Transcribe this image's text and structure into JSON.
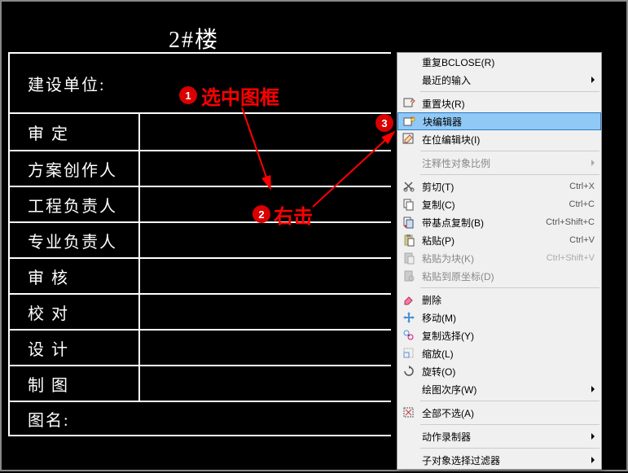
{
  "cad": {
    "title": "2#楼",
    "builder_label": "建设单位:",
    "rows": [
      {
        "label": "审    定"
      },
      {
        "label": "方案创作人"
      },
      {
        "label": "工程负责人"
      },
      {
        "label": "专业负责人"
      },
      {
        "label": "审    核"
      },
      {
        "label": "校    对"
      },
      {
        "label": "设    计"
      },
      {
        "label": "制    图"
      },
      {
        "label": "图名:"
      }
    ]
  },
  "annotations": {
    "badge1": "1",
    "text1": "选中图框",
    "badge2": "2",
    "text2": "右击",
    "badge3": "3"
  },
  "menu": {
    "items": [
      {
        "label": "重复BCLOSE(R)"
      },
      {
        "label": "最近的输入",
        "submenu": true
      },
      {
        "sep": true
      },
      {
        "icon": "reset-block-icon",
        "label": "重置块(R)"
      },
      {
        "icon": "block-editor-icon",
        "label": "块编辑器",
        "highlighted": true
      },
      {
        "icon": "edit-inplace-icon",
        "label": "在位编辑块(I)"
      },
      {
        "sep": true
      },
      {
        "label": "注释性对象比例",
        "disabled": true,
        "submenu": true
      },
      {
        "sep": true
      },
      {
        "icon": "cut-icon",
        "label": "剪切(T)",
        "shortcut": "Ctrl+X"
      },
      {
        "icon": "copy-icon",
        "label": "复制(C)",
        "shortcut": "Ctrl+C"
      },
      {
        "icon": "copy-base-icon",
        "label": "带基点复制(B)",
        "shortcut": "Ctrl+Shift+C"
      },
      {
        "icon": "paste-icon",
        "label": "粘贴(P)",
        "shortcut": "Ctrl+V"
      },
      {
        "icon": "paste-block-icon",
        "label": "粘贴为块(K)",
        "shortcut": "Ctrl+Shift+V",
        "disabled": true
      },
      {
        "icon": "paste-orig-icon",
        "label": "粘贴到原坐标(D)",
        "disabled": true
      },
      {
        "sep": true
      },
      {
        "icon": "erase-icon",
        "label": "删除"
      },
      {
        "icon": "move-icon",
        "label": "移动(M)"
      },
      {
        "icon": "copy-sel-icon",
        "label": "复制选择(Y)"
      },
      {
        "icon": "scale-icon",
        "label": "缩放(L)"
      },
      {
        "icon": "rotate-icon",
        "label": "旋转(O)"
      },
      {
        "label": "绘图次序(W)",
        "submenu": true
      },
      {
        "sep": true
      },
      {
        "icon": "deselect-icon",
        "label": "全部不选(A)"
      },
      {
        "sep": true
      },
      {
        "label": "动作录制器",
        "submenu": true
      },
      {
        "sep": true
      },
      {
        "label": "子对象选择过滤器",
        "submenu": true
      }
    ]
  }
}
